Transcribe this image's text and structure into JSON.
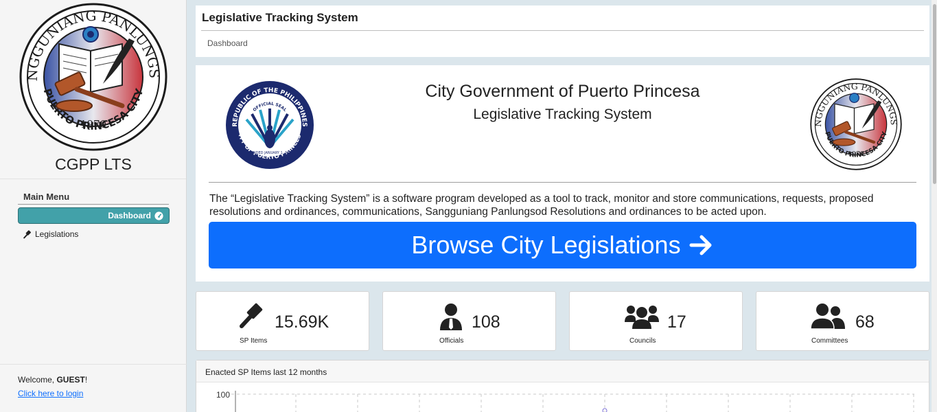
{
  "sidebar": {
    "logo_text_top": "SANGGUNIANG PANLUNGSOD",
    "logo_text_bottom": "PUERTO PRINCESA CITY",
    "logo_year": "1970",
    "brand_name": "CGPP LTS",
    "menu_heading": "Main Menu",
    "items": [
      {
        "label": "Dashboard",
        "icon": "gauge-icon",
        "active": true
      },
      {
        "label": "Legislations",
        "icon": "gavel-icon",
        "active": false
      }
    ],
    "welcome_prefix": "Welcome, ",
    "welcome_user": "GUEST",
    "welcome_suffix": "!",
    "login_link": "Click here to login"
  },
  "header": {
    "title": "Legislative Tracking System",
    "breadcrumb": "Dashboard"
  },
  "hero": {
    "title": "City Government of Puerto Princesa",
    "subtitle": "Legislative Tracking System",
    "seal_left_text_top": "REPUBLIC OF THE PHILIPPINES",
    "seal_left_text_bottom": "CITY OF PUERTO PRINCESA",
    "seal_left_inner": "OFFICIAL SEAL",
    "seal_left_founded": "FOUNDED JANUARY 1, 1970",
    "description": "The “Legislative Tracking System” is a software program developed as a tool to track, monitor and store communications, requests, proposed resolutions and ordinances, communications, Sangguniang Panlungsod Resolutions and ordinances to be acted upon.",
    "browse_button": "Browse City Legislations"
  },
  "stats": [
    {
      "value": "15.69K",
      "label": "SP Items",
      "icon": "gavel-icon"
    },
    {
      "value": "108",
      "label": "Officials",
      "icon": "user-tie-icon"
    },
    {
      "value": "17",
      "label": "Councils",
      "icon": "users-icon"
    },
    {
      "value": "68",
      "label": "Committees",
      "icon": "user-friends-icon"
    }
  ],
  "chart": {
    "title": "Enacted SP Items last 12 months"
  },
  "chart_data": {
    "type": "line",
    "title": "Enacted SP Items last 12 months",
    "yticks": [
      "100"
    ],
    "grid": true,
    "colors": {
      "line": "#7b6fd6"
    }
  },
  "colors": {
    "accent": "#42a1a9",
    "primary": "#0d6efd",
    "background": "#dbe6ec"
  }
}
